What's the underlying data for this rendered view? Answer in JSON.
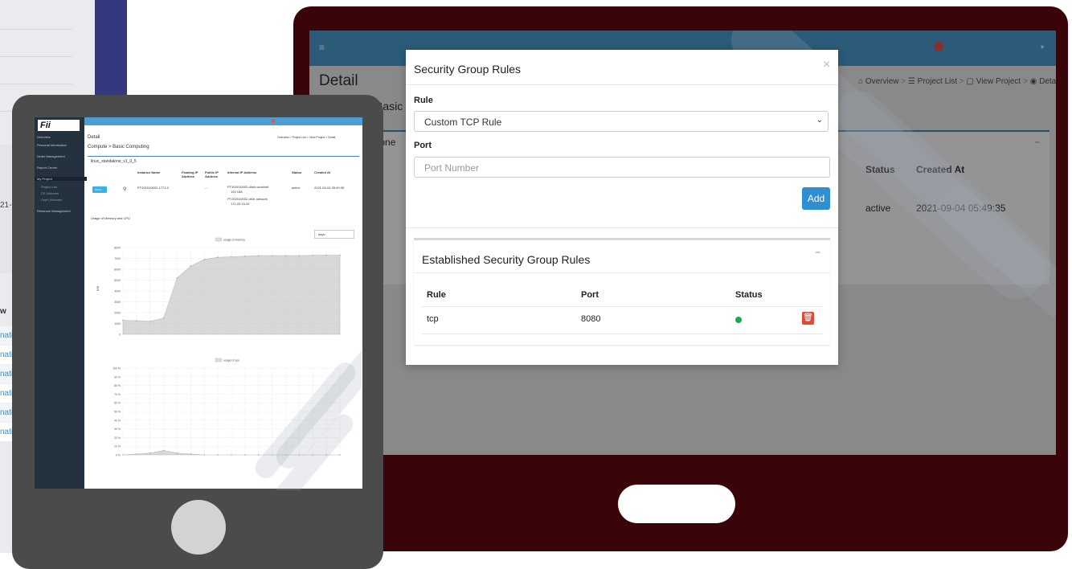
{
  "back_screen": {
    "title": "Detail",
    "heading_partial": "Basic",
    "instance_partial": "alone",
    "breadcrumb": [
      "Overview",
      "Project List",
      "View Project",
      "Detail"
    ],
    "table_headers": [
      "Status",
      "Created At"
    ],
    "row": {
      "status": "active",
      "created": "2021-09-04 05:49:35"
    }
  },
  "left_panel": {
    "header_partial": "w",
    "date_partial": "21-0",
    "rows": [
      "nati",
      "nati",
      "nati",
      "nati",
      "nati",
      "nati"
    ]
  },
  "tablet": {
    "sidebar_items": [
      "Overview",
      "Personal Information",
      "Order Management",
      "Report Center",
      "My Project",
      "Project List",
      "CE Volumes",
      "Ceph Volumes",
      "Resource Management"
    ],
    "title": "Detail",
    "subtitle": "Compute > Basic Computing",
    "breadcrumb": "Overview > Project List > View Project > Detail",
    "instance": "linux_standalone_v1_0_5",
    "headers": [
      "Instance Name",
      "Floating IP Address",
      "Public IP Address",
      "Internal IP Address",
      "Status",
      "Created At"
    ],
    "row": {
      "action": "Action",
      "name": "PT202010002-1771-0",
      "floating": "--",
      "internal_1": "PT202010002-dhsh-workinet",
      "internal_1_ip": "192.168",
      "internal_2": "PT202010002-dh3r-network",
      "internal_2_ip": "172.20.15.20",
      "status": "active",
      "created": "2021-09-04 05:49:35"
    },
    "usage_title": "Usage of Memory and CPU",
    "range_select": "days",
    "chart_data": [
      {
        "type": "area",
        "title": "",
        "legend": "usage of memory",
        "ylabel": "MiB",
        "ylim": [
          0,
          8000
        ],
        "yticks": [
          0,
          1000,
          2000,
          3000,
          4000,
          5000,
          6000,
          7000,
          8000
        ],
        "x": [
          "t1",
          "t2",
          "t3",
          "t4",
          "t5",
          "t6",
          "t7",
          "t8",
          "t9",
          "t10",
          "t11",
          "t12",
          "t13",
          "t14",
          "t15",
          "t16",
          "t17"
        ],
        "series": [
          {
            "name": "usage of memory",
            "values": [
              1300,
              1250,
              1200,
              1500,
              5200,
              6300,
              6900,
              7100,
              7150,
              7200,
              7250,
              7250,
              7250,
              7250,
              7280,
              7300,
              7300
            ]
          }
        ]
      },
      {
        "type": "area",
        "title": "",
        "legend": "usage of cpu",
        "ylim": [
          0,
          100
        ],
        "yticks": [
          0,
          10,
          20,
          30,
          40,
          50,
          60,
          70,
          80,
          90,
          100
        ],
        "x": [
          "t1",
          "t2",
          "t3",
          "t4",
          "t5",
          "t6",
          "t7",
          "t8",
          "t9",
          "t10",
          "t11",
          "t12",
          "t13",
          "t14",
          "t15",
          "t16",
          "t17"
        ],
        "series": [
          {
            "name": "usage of cpu",
            "values": [
              0,
              1,
              2,
              5,
              2,
              1,
              0,
              0,
              0,
              0,
              0,
              0,
              0,
              0,
              0,
              0,
              0
            ]
          }
        ]
      }
    ]
  },
  "modal": {
    "title": "Security Group Rules",
    "close": "×",
    "rule_label": "Rule",
    "rule_value": "Custom TCP Rule",
    "port_label": "Port",
    "port_placeholder": "Port Number",
    "add_label": "Add",
    "established_title": "Established Security Group Rules",
    "collapse": "−",
    "headers": {
      "rule": "Rule",
      "port": "Port",
      "status": "Status"
    },
    "row": {
      "rule": "tcp",
      "port": "8080"
    }
  },
  "colors": {
    "topbar": "#4a9ed1",
    "monitor": "#3a0509",
    "add_button": "#2f8fd0",
    "active_dot": "#1fa64d",
    "delete": "#dd4b39"
  }
}
